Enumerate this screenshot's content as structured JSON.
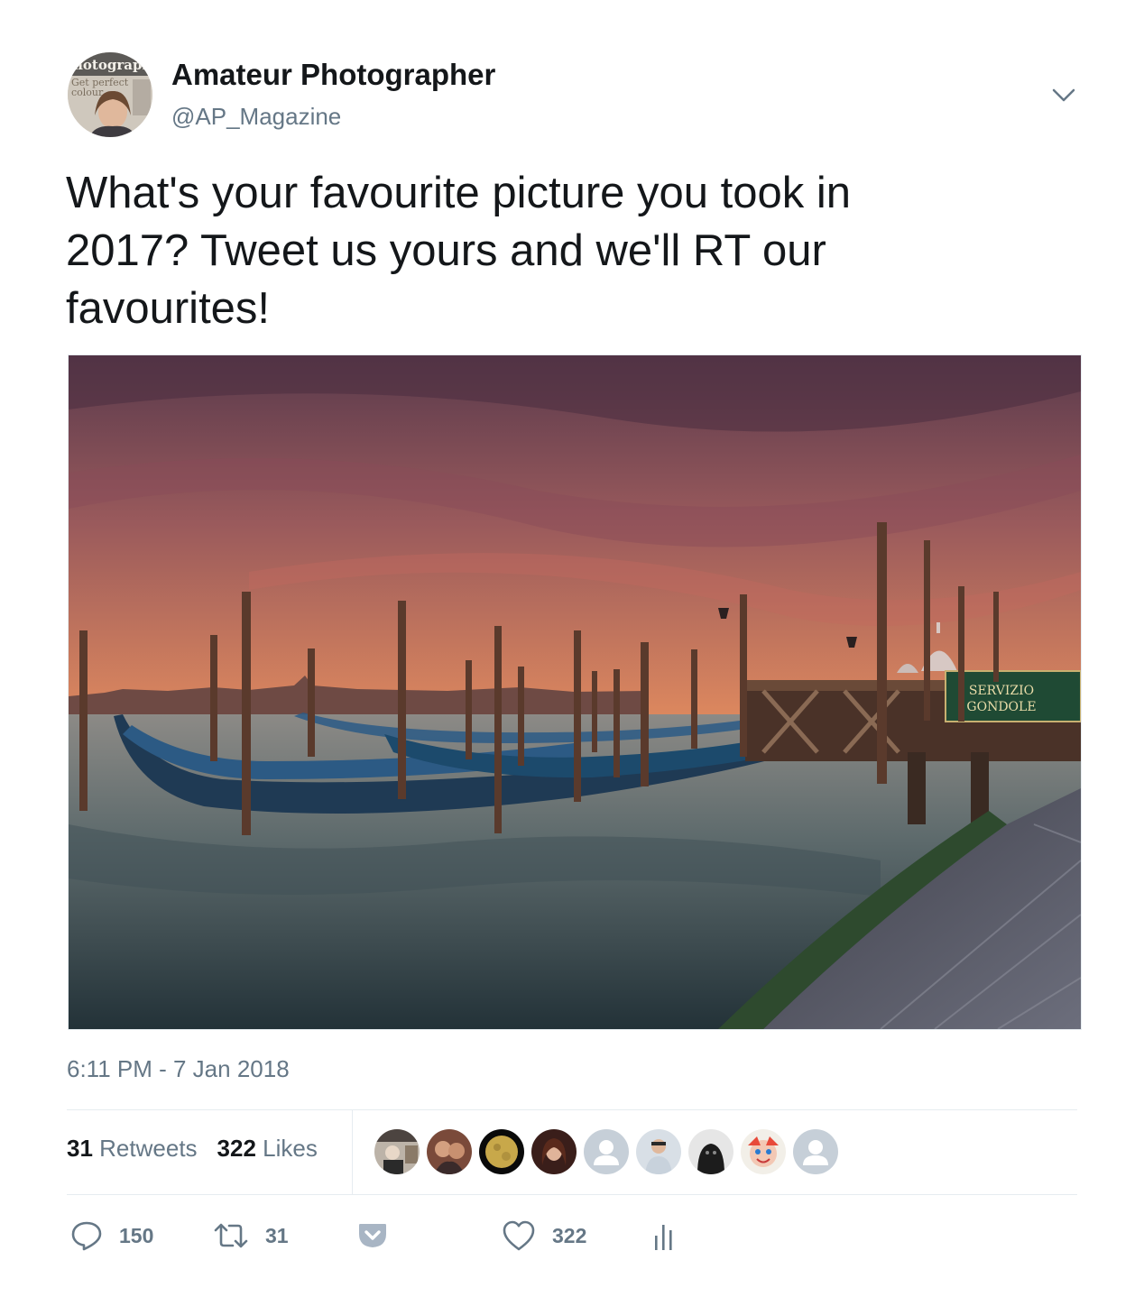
{
  "author": {
    "name": "Amateur Photographer",
    "handle": "@AP_Magazine",
    "avatar_text": [
      "hotographe",
      "Get perfect",
      "colour"
    ]
  },
  "tweet": {
    "text": "What's your favourite picture you took in\n2017? Tweet us yours and we'll RT our\nfavourites!",
    "timestamp": "6:11 PM - 7 Jan 2018"
  },
  "media": {
    "sign_line1": "SERVIZIO",
    "sign_line2": "GONDOLE"
  },
  "stats": {
    "retweets_count": "31",
    "retweets_label": "Retweets",
    "likes_count": "322",
    "likes_label": "Likes"
  },
  "likers": [
    "avatar-photo",
    "avatar-photo",
    "avatar-moon",
    "avatar-photo",
    "default-avatar",
    "avatar-photo",
    "avatar-photo",
    "avatar-cartoon",
    "default-avatar"
  ],
  "actions": {
    "replies": "150",
    "retweets": "31",
    "likes": "322"
  },
  "icons": {
    "reply": "reply-icon",
    "retweet": "retweet-icon",
    "pocket": "pocket-icon",
    "like": "heart-icon",
    "analytics": "analytics-icon",
    "menu": "chevron-down-icon"
  },
  "colors": {
    "text": "#14171a",
    "secondary": "#657786",
    "pocket": "#a8b5c4",
    "divider": "#e6ecf0"
  }
}
